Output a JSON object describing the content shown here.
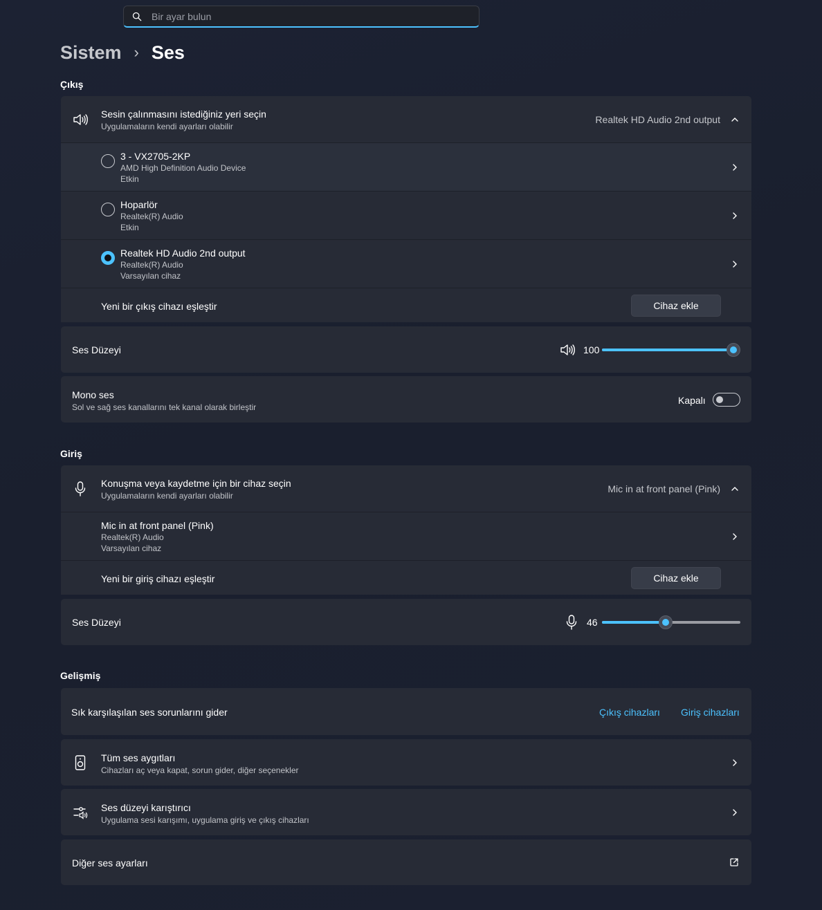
{
  "search": {
    "placeholder": "Bir ayar bulun"
  },
  "breadcrumb": {
    "parent": "Sistem",
    "separator": "›",
    "current": "Ses"
  },
  "output": {
    "section_title": "Çıkış",
    "header": {
      "title": "Sesin çalınmasını istediğiniz yeri seçin",
      "subtitle": "Uygulamaların kendi ayarları olabilir",
      "selected": "Realtek HD Audio 2nd output"
    },
    "devices": [
      {
        "name": "3 - VX2705-2KP",
        "driver": "AMD High Definition Audio Device",
        "status": "Etkin",
        "selected": false
      },
      {
        "name": "Hoparlör",
        "driver": "Realtek(R) Audio",
        "status": "Etkin",
        "selected": false
      },
      {
        "name": "Realtek HD Audio 2nd output",
        "driver": "Realtek(R) Audio",
        "status": "Varsayılan cihaz",
        "selected": true
      }
    ],
    "pair": {
      "label": "Yeni bir çıkış cihazı eşleştir",
      "button": "Cihaz ekle"
    },
    "volume": {
      "label": "Ses Düzeyi",
      "value": "100",
      "level": 1.0
    },
    "mono": {
      "title": "Mono ses",
      "subtitle": "Sol ve sağ ses kanallarını tek kanal olarak birleştir",
      "state_label": "Kapalı",
      "on": false
    }
  },
  "input": {
    "section_title": "Giriş",
    "header": {
      "title": "Konuşma veya kaydetme için bir cihaz seçin",
      "subtitle": "Uygulamaların kendi ayarları olabilir",
      "selected": "Mic in at front panel (Pink)"
    },
    "devices": [
      {
        "name": "Mic in at front panel (Pink)",
        "driver": "Realtek(R) Audio",
        "status": "Varsayılan cihaz"
      }
    ],
    "pair": {
      "label": "Yeni bir giriş cihazı eşleştir",
      "button": "Cihaz ekle"
    },
    "volume": {
      "label": "Ses Düzeyi",
      "value": "46",
      "level": 0.46
    }
  },
  "advanced": {
    "section_title": "Gelişmiş",
    "troubleshoot": {
      "label": "Sık karşılaşılan ses sorunlarını gider",
      "output_link": "Çıkış cihazları",
      "input_link": "Giriş cihazları"
    },
    "all_devices": {
      "title": "Tüm ses aygıtları",
      "subtitle": "Cihazları aç veya kapat, sorun gider, diğer seçenekler"
    },
    "mixer": {
      "title": "Ses düzeyi karıştırıcı",
      "subtitle": "Uygulama sesi karışımı, uygulama giriş ve çıkış cihazları"
    },
    "more": {
      "label": "Diğer ses ayarları"
    }
  },
  "colors": {
    "accent": "#4cc2ff",
    "card": "#272b36",
    "background": "#1c2233"
  }
}
